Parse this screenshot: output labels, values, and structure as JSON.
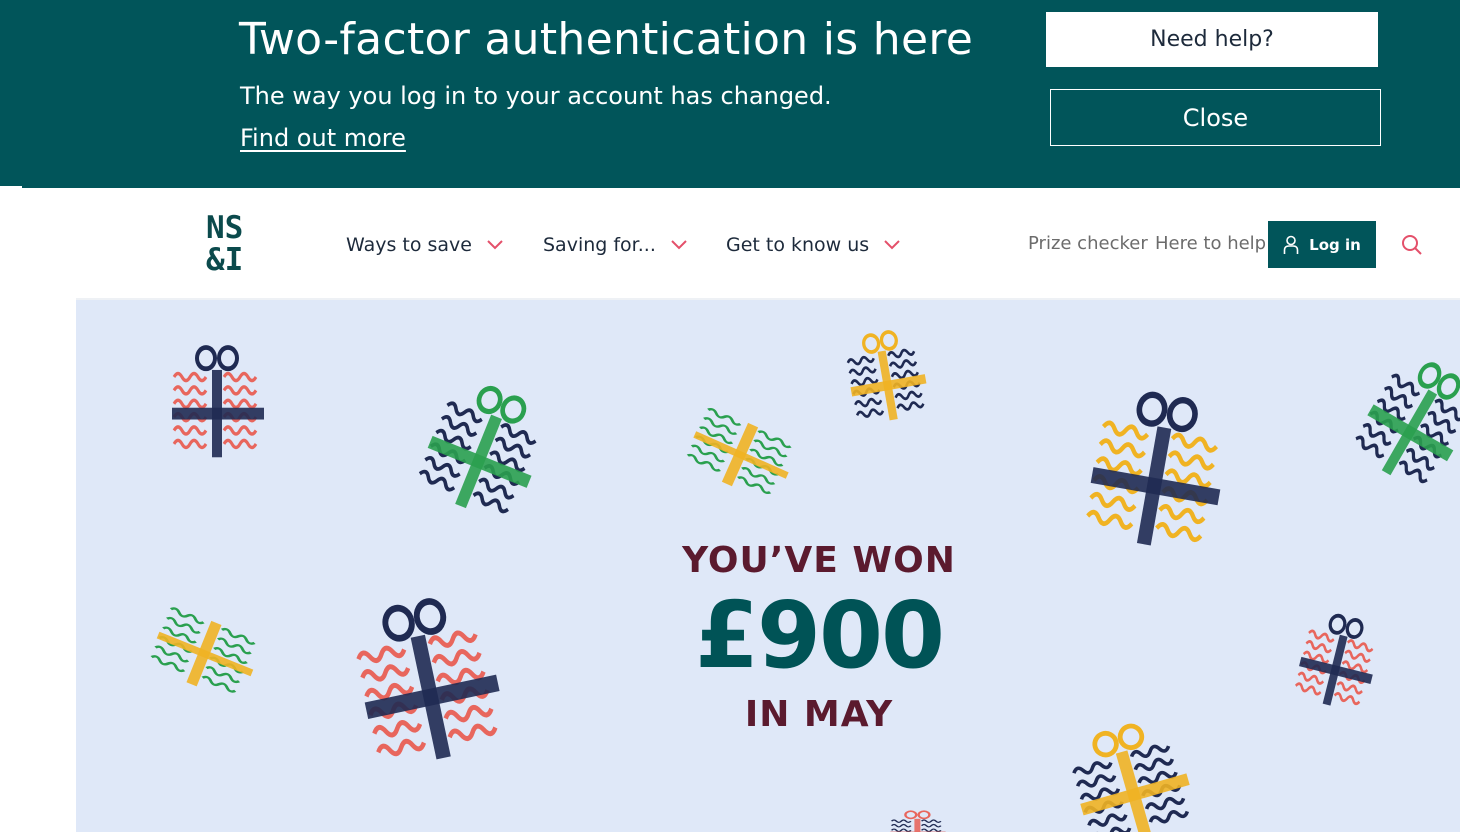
{
  "banner": {
    "title": "Two-factor authentication is here",
    "text": "The way you log in to your account has changed.",
    "link": "Find out more",
    "help_button": "Need help?",
    "close_button": "Close"
  },
  "header": {
    "logo": {
      "line1": "NS",
      "line2": "&I"
    },
    "nav": [
      {
        "label": "Ways to save"
      },
      {
        "label": "Saving for..."
      },
      {
        "label": "Get to know us"
      }
    ],
    "links": [
      {
        "label": "Prize checker"
      },
      {
        "label": "Here to help"
      }
    ],
    "login_button": "Log in"
  },
  "hero": {
    "kicker": "YOU’VE WON",
    "amount": "£900",
    "month": "IN MAY"
  },
  "colors": {
    "brand_teal": "#01555a",
    "hero_bg": "#dfe8f8",
    "maroon": "#5b1a2e",
    "gift_navy": "#1f2a52",
    "gift_red": "#e8665d",
    "gift_green": "#2aa04f",
    "gift_yellow": "#f0b323"
  },
  "icons": [
    "chevron-down-icon",
    "user-icon",
    "search-icon",
    "gift-icon"
  ]
}
